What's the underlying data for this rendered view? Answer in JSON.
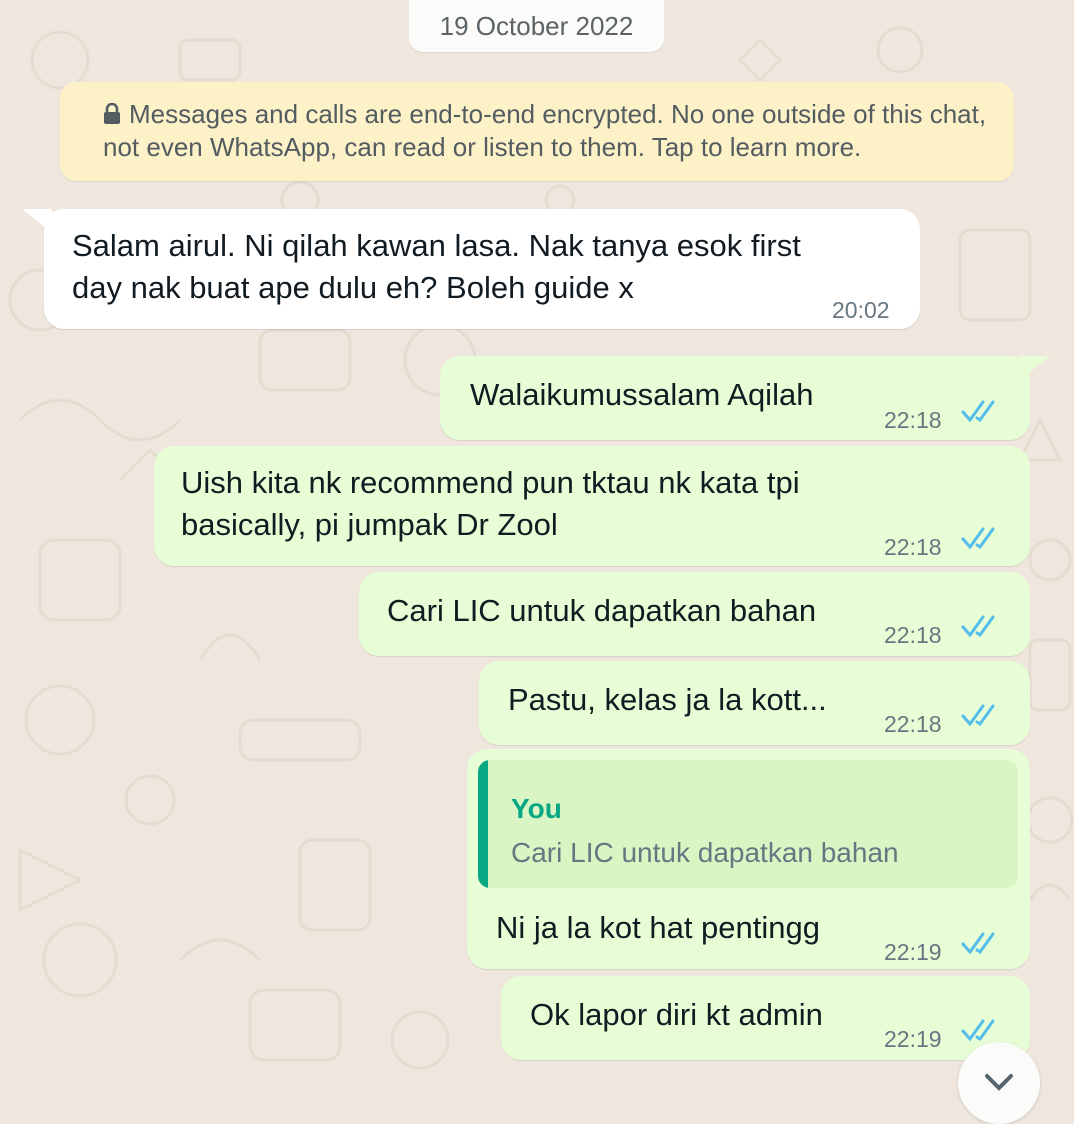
{
  "date_divider": "19 October 2022",
  "encryption_notice": {
    "icon": "lock-icon",
    "text": "Messages and calls are end-to-end encrypted. No one outside of this chat, not even WhatsApp, can read or listen to them. Tap to learn more."
  },
  "messages": [
    {
      "direction": "incoming",
      "lines": [
        "Salam airul. Ni qilah kawan lasa. Nak tanya esok first",
        "day nak buat ape dulu eh? Boleh guide x"
      ],
      "time": "20:02"
    },
    {
      "direction": "outgoing",
      "lines": [
        "Walaikumussalam Aqilah"
      ],
      "time": "22:18",
      "status": "read"
    },
    {
      "direction": "outgoing",
      "lines": [
        "Uish kita nk recommend pun tktau nk kata tpi",
        "basically, pi jumpak Dr Zool"
      ],
      "time": "22:18",
      "status": "read"
    },
    {
      "direction": "outgoing",
      "lines": [
        "Cari LIC untuk dapatkan bahan"
      ],
      "time": "22:18",
      "status": "read"
    },
    {
      "direction": "outgoing",
      "lines": [
        "Pastu, kelas ja la kott..."
      ],
      "time": "22:18",
      "status": "read"
    },
    {
      "direction": "outgoing",
      "quoted": {
        "author": "You",
        "text": "Cari LIC untuk dapatkan bahan"
      },
      "lines": [
        "Ni ja la kot hat pentingg"
      ],
      "time": "22:19",
      "status": "read"
    },
    {
      "direction": "outgoing",
      "lines": [
        "Ok lapor diri kt admin"
      ],
      "time": "22:19",
      "status": "read"
    }
  ],
  "read_receipt_color": "#53bdeb",
  "outgoing_bubble_color": "#e7fdd5",
  "incoming_bubble_color": "#ffffff",
  "scroll_button_icon": "chevron-down-icon"
}
